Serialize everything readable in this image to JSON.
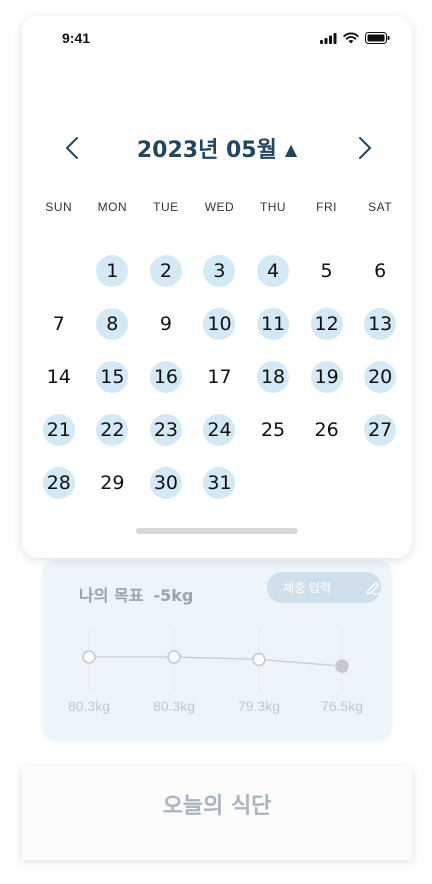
{
  "status_bar": {
    "time": "9:41"
  },
  "calendar": {
    "month_title": "2023년 05월",
    "caret": "▲",
    "weekdays": [
      "SUN",
      "MON",
      "TUE",
      "WED",
      "THU",
      "FRI",
      "SAT"
    ],
    "weeks": [
      [
        {
          "d": "",
          "m": false
        },
        {
          "d": "1",
          "m": true
        },
        {
          "d": "2",
          "m": true
        },
        {
          "d": "3",
          "m": true
        },
        {
          "d": "4",
          "m": true
        },
        {
          "d": "5",
          "m": false
        },
        {
          "d": "6",
          "m": false
        }
      ],
      [
        {
          "d": "7",
          "m": false
        },
        {
          "d": "8",
          "m": true
        },
        {
          "d": "9",
          "m": false
        },
        {
          "d": "10",
          "m": true
        },
        {
          "d": "11",
          "m": true
        },
        {
          "d": "12",
          "m": true
        },
        {
          "d": "13",
          "m": true
        }
      ],
      [
        {
          "d": "14",
          "m": false
        },
        {
          "d": "15",
          "m": true
        },
        {
          "d": "16",
          "m": true
        },
        {
          "d": "17",
          "m": false
        },
        {
          "d": "18",
          "m": true
        },
        {
          "d": "19",
          "m": true
        },
        {
          "d": "20",
          "m": true
        }
      ],
      [
        {
          "d": "21",
          "m": true
        },
        {
          "d": "22",
          "m": true
        },
        {
          "d": "23",
          "m": true
        },
        {
          "d": "24",
          "m": true
        },
        {
          "d": "25",
          "m": false
        },
        {
          "d": "26",
          "m": false
        },
        {
          "d": "27",
          "m": true
        }
      ],
      [
        {
          "d": "28",
          "m": true
        },
        {
          "d": "29",
          "m": false
        },
        {
          "d": "30",
          "m": true
        },
        {
          "d": "31",
          "m": true
        },
        {
          "d": "",
          "m": false
        },
        {
          "d": "",
          "m": false
        },
        {
          "d": "",
          "m": false
        }
      ]
    ]
  },
  "goal": {
    "label": "나의 목표",
    "value": "-5kg",
    "weigh_button": "체중 입력",
    "weights": [
      "80.3kg",
      "80.3kg",
      "79.3kg",
      "76.5kg"
    ],
    "weight_values": [
      80.3,
      80.3,
      79.3,
      76.5
    ],
    "last_point_filled": true
  },
  "meal": {
    "title": "오늘의 식단"
  },
  "colors": {
    "accent": "#1f4763",
    "marked_day": "#d3e9f5",
    "goal_bg": "#edf5fa"
  }
}
